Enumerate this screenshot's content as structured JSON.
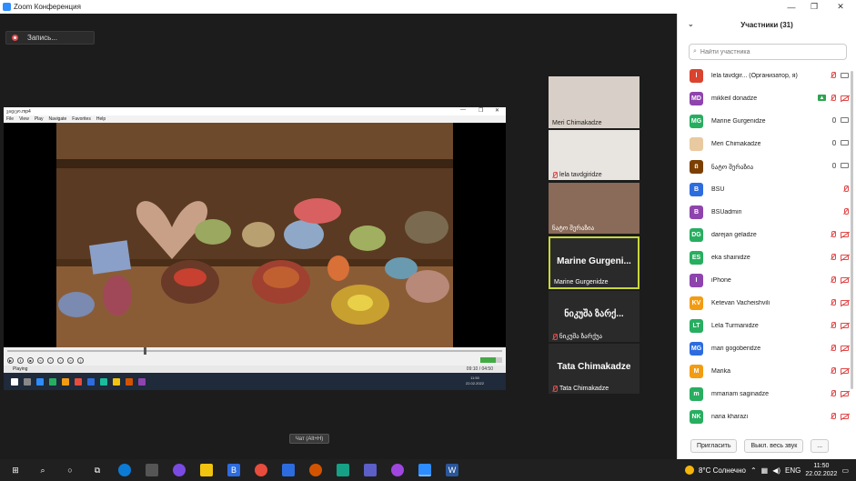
{
  "window": {
    "title": "Zoom Конференция",
    "minimize": "—",
    "restore": "❐",
    "close": "✕"
  },
  "recording": {
    "label": "Запись..."
  },
  "player": {
    "title": "ვიდეო.mp4",
    "menu": [
      "File",
      "View",
      "Play",
      "Navigate",
      "Favorites",
      "Help"
    ],
    "status": "Playing",
    "time": "09:10 / 04:50",
    "res": "1080",
    "clock_time": "11:50",
    "clock_date": "22.02.2022",
    "lang": "ENG"
  },
  "gallery": [
    {
      "name": "Meri Chimakadze",
      "big": ""
    },
    {
      "name": "lela tavdgiridze",
      "big": ""
    },
    {
      "name": "ნატო შერაზია",
      "big": ""
    },
    {
      "name": "Marine Gurgenidze",
      "big": "Marine Gurgeni..."
    },
    {
      "name": "ნიკუშა ზარქუა",
      "big": "ნიკუშა ზარქ..."
    },
    {
      "name": "Tata Chimakadze",
      "big": "Tata Chimakadze"
    }
  ],
  "chat_pill": "Чат (Alt+H)",
  "panel": {
    "title": "Участники (31)",
    "search_placeholder": "Найти участника",
    "participants": [
      {
        "initials": "l",
        "name": "lela tavdgir... (Организатор, я)",
        "color": "#d9432f"
      },
      {
        "initials": "MD",
        "name": "mikkeil donadze",
        "color": "#8e44ad"
      },
      {
        "initials": "MG",
        "name": "Marine Gurgenidze",
        "color": "#27ae60"
      },
      {
        "initials": "",
        "name": "Meri Chimakadze",
        "color": "#e8c9a0"
      },
      {
        "initials": "ព",
        "name": "ნატო შერაზია",
        "color": "#7b3f00"
      },
      {
        "initials": "B",
        "name": "BSU",
        "color": "#2d6cdf"
      },
      {
        "initials": "B",
        "name": "BSUadmin",
        "color": "#8e44ad"
      },
      {
        "initials": "DG",
        "name": "darejan geladze",
        "color": "#27ae60"
      },
      {
        "initials": "ES",
        "name": "eka shainidze",
        "color": "#27ae60"
      },
      {
        "initials": "I",
        "name": "iPhone",
        "color": "#8e44ad"
      },
      {
        "initials": "KV",
        "name": "Ketevan Vacheishvili",
        "color": "#f39c12"
      },
      {
        "initials": "LT",
        "name": "Lela Turmanidze",
        "color": "#27ae60"
      },
      {
        "initials": "MG",
        "name": "mari gogoberidze",
        "color": "#2d6cdf"
      },
      {
        "initials": "M",
        "name": "Marika",
        "color": "#f39c12"
      },
      {
        "initials": "m",
        "name": "mmariam saginadze",
        "color": "#27ae60"
      },
      {
        "initials": "NK",
        "name": "nana kharazi",
        "color": "#27ae60"
      }
    ],
    "invite": "Пригласить",
    "mute_all": "Выкл. весь звук",
    "more": "..."
  },
  "taskbar": {
    "weather": "8°C Солнечно",
    "lang": "ENG",
    "time": "11:50",
    "date": "22.02.2022"
  }
}
